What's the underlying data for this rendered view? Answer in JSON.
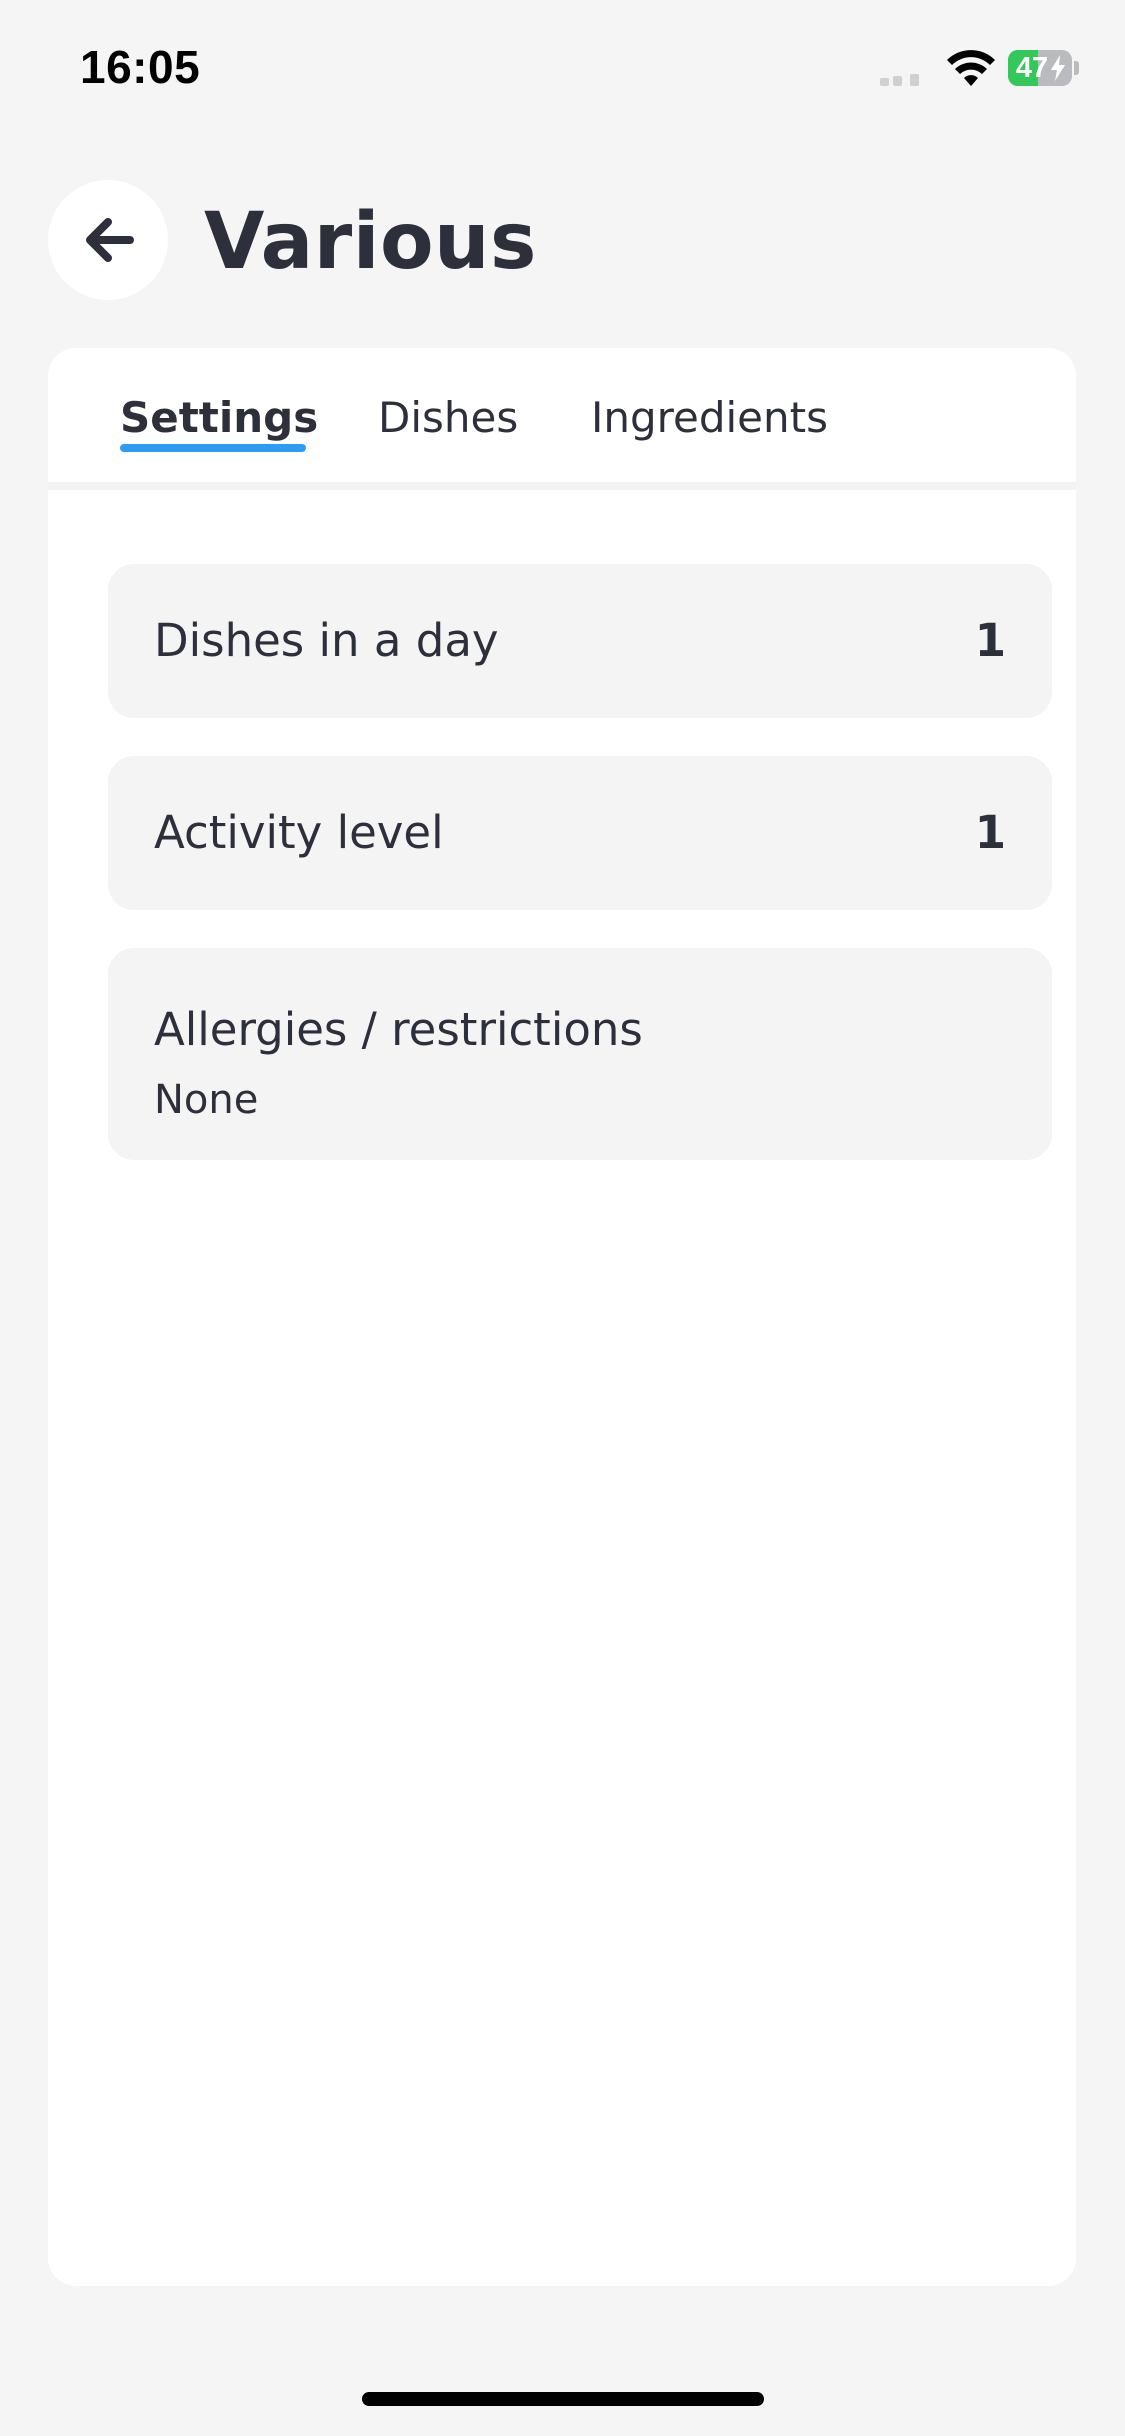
{
  "status_bar": {
    "time": "16:05",
    "battery_level": "47",
    "battery_fraction": 0.47,
    "battery_color": "#34c759",
    "icons": [
      "signal-icon",
      "wifi-icon",
      "battery-icon",
      "charging-bolt-icon"
    ]
  },
  "header": {
    "title": "Various",
    "back_icon": "arrow-left-icon"
  },
  "tabs": [
    {
      "label": "Settings",
      "active": true
    },
    {
      "label": "Dishes",
      "active": false
    },
    {
      "label": "Ingredients",
      "active": false
    }
  ],
  "accent_color": "#2d9cf4",
  "settings": [
    {
      "label": "Dishes in a day",
      "value": "1"
    },
    {
      "label": "Activity level",
      "value": "1"
    },
    {
      "label": "Allergies / restrictions",
      "value": "None"
    }
  ]
}
